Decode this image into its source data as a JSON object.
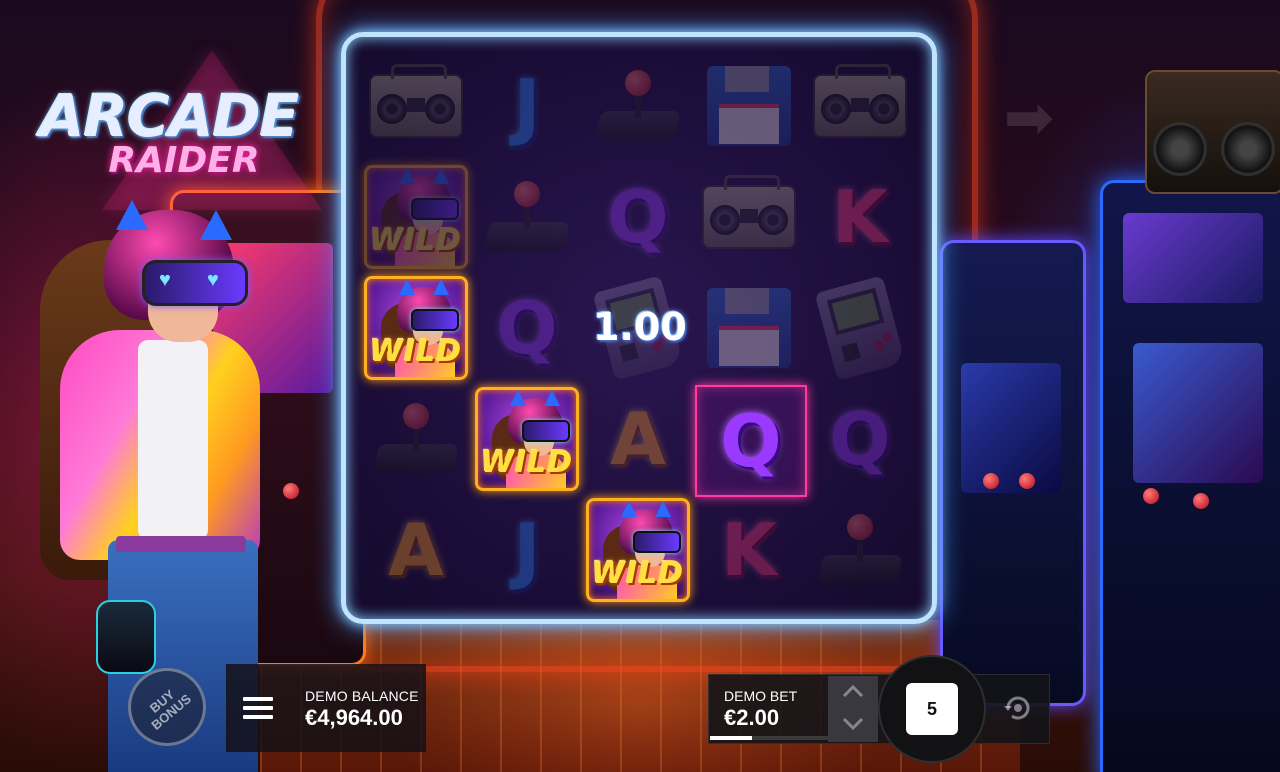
{
  "logo": {
    "line1": "ARCADE",
    "line2": "RAIDER"
  },
  "reels": {
    "rows": [
      [
        {
          "symbol": "boombox",
          "dim": true
        },
        {
          "symbol": "J",
          "dim": true
        },
        {
          "symbol": "joystick",
          "dim": true
        },
        {
          "symbol": "floppy",
          "dim": true
        },
        {
          "symbol": "boombox",
          "dim": true
        }
      ],
      [
        {
          "symbol": "WILD",
          "dim": true
        },
        {
          "symbol": "joystick",
          "dim": true
        },
        {
          "symbol": "Q",
          "dim": true
        },
        {
          "symbol": "boombox",
          "dim": true
        },
        {
          "symbol": "K",
          "dim": true
        }
      ],
      [
        {
          "symbol": "WILD",
          "dim": false
        },
        {
          "symbol": "Q",
          "dim": true
        },
        {
          "symbol": "gameboy",
          "dim": true
        },
        {
          "symbol": "floppy",
          "dim": true
        },
        {
          "symbol": "gameboy",
          "dim": true
        }
      ],
      [
        {
          "symbol": "joystick",
          "dim": true
        },
        {
          "symbol": "WILD",
          "dim": false
        },
        {
          "symbol": "A",
          "dim": true
        },
        {
          "symbol": "Q",
          "dim": false
        },
        {
          "symbol": "Q",
          "dim": true
        }
      ],
      [
        {
          "symbol": "A",
          "dim": true
        },
        {
          "symbol": "J",
          "dim": true
        },
        {
          "symbol": "WILD",
          "dim": false
        },
        {
          "symbol": "K",
          "dim": true
        },
        {
          "symbol": "joystick",
          "dim": true
        }
      ]
    ],
    "win_amount": "1.00",
    "wild_label": "WILD"
  },
  "buy_bonus": {
    "label": "BUY BONUS"
  },
  "balance": {
    "label": "DEMO BALANCE",
    "value": "€4,964.00"
  },
  "bet": {
    "label": "DEMO BET",
    "value": "€2.00",
    "level_fraction": 0.36
  },
  "spin": {
    "label": "5"
  },
  "icons": {
    "menu": "menu-icon",
    "bet_up": "chevron-up-icon",
    "bet_down": "chevron-down-icon",
    "autoplay": "autoplay-icon",
    "next": "arrow-right-icon"
  }
}
